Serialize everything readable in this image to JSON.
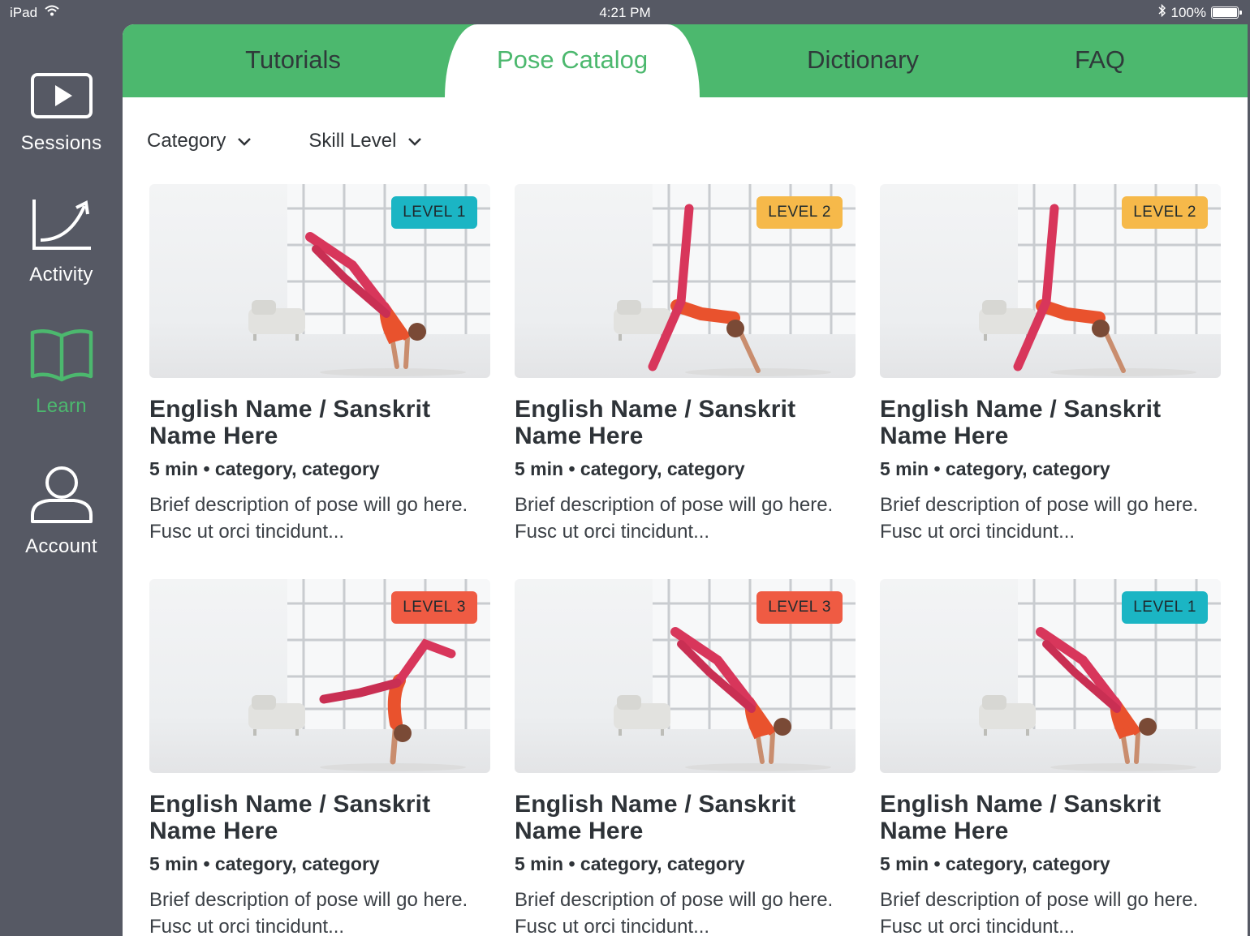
{
  "status_bar": {
    "device": "iPad",
    "time": "4:21 PM",
    "battery": "100%",
    "battery_level": 1.0
  },
  "sidebar": {
    "items": [
      {
        "label": "Sessions",
        "icon": "play-icon",
        "active": false
      },
      {
        "label": "Activity",
        "icon": "chart-icon",
        "active": false
      },
      {
        "label": "Learn",
        "icon": "book-icon",
        "active": true
      },
      {
        "label": "Account",
        "icon": "person-icon",
        "active": false
      }
    ]
  },
  "tabs": [
    {
      "label": "Tutorials",
      "active": false
    },
    {
      "label": "Pose Catalog",
      "active": true
    },
    {
      "label": "Dictionary",
      "active": false
    },
    {
      "label": "FAQ",
      "active": false
    }
  ],
  "filters": {
    "category": "Category",
    "skill_level": "Skill Level"
  },
  "level_colors": {
    "LEVEL 1": "#1bb5c4",
    "LEVEL 2": "#f6b94a",
    "LEVEL 3": "#ef5b43"
  },
  "colors": {
    "accent": "#4cb86e",
    "sidebar": "#565964"
  },
  "cards": [
    {
      "level": "LEVEL 1",
      "title": "English Name / Sanskrit Name Here",
      "meta": "5 min • category, category",
      "description": "Brief description of pose will go here. Fusc ut orci tincidunt..."
    },
    {
      "level": "LEVEL 2",
      "title": "English Name / Sanskrit Name Here",
      "meta": "5 min • category, category",
      "description": "Brief description of pose will go here. Fusc ut orci tincidunt..."
    },
    {
      "level": "LEVEL 2",
      "title": "English Name / Sanskrit Name Here",
      "meta": "5 min • category, category",
      "description": "Brief description of pose will go here. Fusc ut orci tincidunt..."
    },
    {
      "level": "LEVEL 3",
      "title": "English Name / Sanskrit Name Here",
      "meta": "5 min • category, category",
      "description": "Brief description of pose will go here. Fusc ut orci tincidunt..."
    },
    {
      "level": "LEVEL 3",
      "title": "English Name / Sanskrit Name Here",
      "meta": "5 min • category, category",
      "description": "Brief description of pose will go here. Fusc ut orci tincidunt..."
    },
    {
      "level": "LEVEL 1",
      "title": "English Name / Sanskrit Name Here",
      "meta": "5 min • category, category",
      "description": "Brief description of pose will go here. Fusc ut orci tincidunt..."
    }
  ]
}
